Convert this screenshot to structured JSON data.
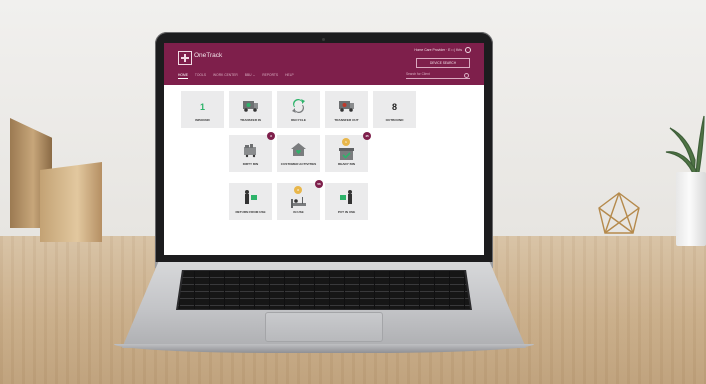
{
  "app": {
    "title": "OneTrack",
    "user_line": "Home Care Provider · E □  |  Kris",
    "device_search_label": "DEVICE SEARCH",
    "search_placeholder": "Search for Client"
  },
  "nav": {
    "items": [
      "HOME",
      "TOOLS",
      "WORK CENTER",
      "BBU ⌄",
      "REPORTS",
      "HELP"
    ]
  },
  "tiles": {
    "inbound": {
      "label": "INBOUND",
      "count": "1"
    },
    "transfer_in": {
      "label": "TRANSFER IN"
    },
    "recycle": {
      "label": "RECYCLE"
    },
    "transfer_out": {
      "label": "TRANSFER OUT"
    },
    "outbound": {
      "label": "OUTBOUND",
      "count": "8"
    },
    "dirty_bin": {
      "label": "DIRTY BIN",
      "badge": "3"
    },
    "customer_activities": {
      "label": "CUSTOMER ACTIVITIES"
    },
    "ready_bin": {
      "label": "READY BIN",
      "badge": "45",
      "badge_small": "1"
    },
    "return_from_use": {
      "label": "RETURN FROM USE"
    },
    "in_use": {
      "label": "IN USE",
      "badge": "56",
      "badge_small": "3"
    },
    "put_in_use": {
      "label": "PUT IN USE"
    }
  },
  "colors": {
    "brand": "#7e1f4b",
    "accent_green": "#2db36a",
    "badge_gold": "#e8b64a"
  }
}
